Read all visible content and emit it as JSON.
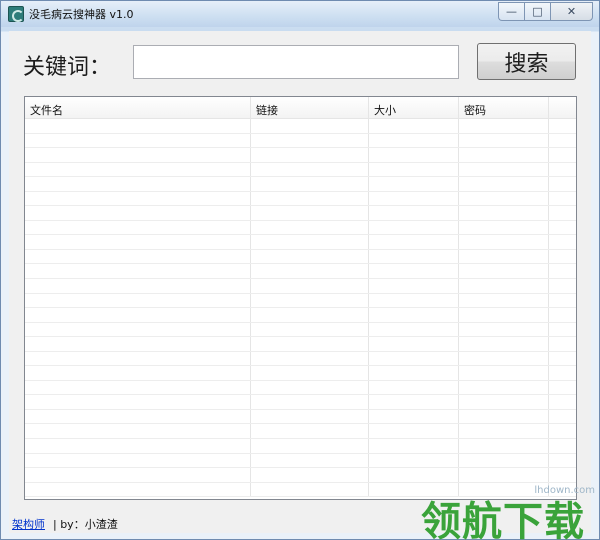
{
  "window": {
    "title": "没毛病云搜神器 v1.0",
    "caption_buttons": {
      "minimize": "—",
      "maximize": "□",
      "close": "✕"
    }
  },
  "search": {
    "label": "关键词：",
    "value": "",
    "button_label": "搜索"
  },
  "results": {
    "columns": [
      "文件名",
      "链接",
      "大小",
      "密码"
    ],
    "rows": []
  },
  "status": {
    "link_label": "架构师",
    "author_text": "| by：小渣渣"
  },
  "watermark": {
    "url": "lhdown.com",
    "text": "领航下载"
  },
  "colors": {
    "link": "#0033cc",
    "watermark": "#3aa33a"
  }
}
